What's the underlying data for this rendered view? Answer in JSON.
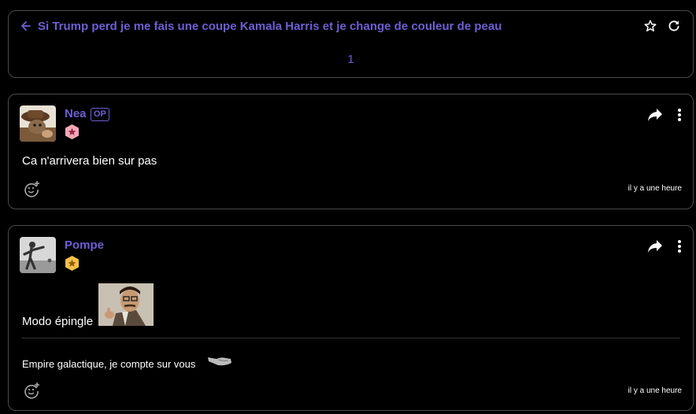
{
  "topic": {
    "title": "Si Trump perd je me fais une coupe Kamala Harris et je change de couleur de peau",
    "page": "1"
  },
  "posts": [
    {
      "username": "Nea",
      "op_label": "OP",
      "text": "Ca n'arrivera bien sur pas",
      "time": "il y a une heure",
      "badge_color": "#f4a9b8"
    },
    {
      "username": "Pompe",
      "text": "Modo épingle",
      "signature": "Empire galactique, je compte sur vous",
      "time": "il y a une heure",
      "badge_color": "#f5c04a"
    }
  ],
  "icons": {
    "back": "arrow-left-icon",
    "favorite": "star-icon",
    "refresh": "refresh-icon",
    "share": "share-icon",
    "menu": "kebab-menu-icon",
    "react": "emoji-add-icon"
  }
}
